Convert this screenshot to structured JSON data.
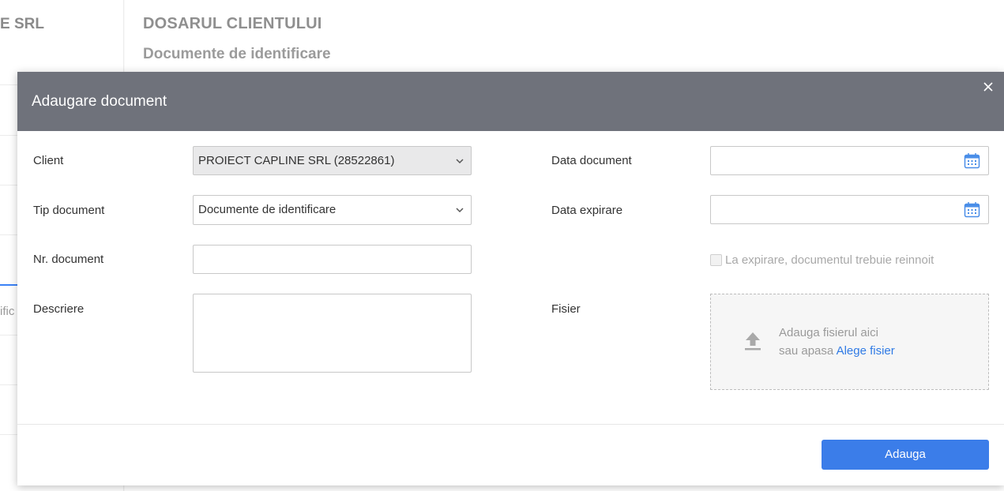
{
  "background": {
    "company_partial": "E SRL",
    "page_title": "DOSARUL CLIENTULUI",
    "page_subtitle": "Documente de identificare",
    "sidebar_partial_text": "ific"
  },
  "modal": {
    "title": "Adaugare document",
    "close_icon": "close-icon",
    "fields": {
      "client": {
        "label": "Client",
        "value": "PROIECT CAPLINE SRL (28522861)"
      },
      "tip_document": {
        "label": "Tip document",
        "value": "Documente de identificare"
      },
      "nr_document": {
        "label": "Nr. document",
        "value": ""
      },
      "descriere": {
        "label": "Descriere",
        "value": ""
      },
      "data_document": {
        "label": "Data document",
        "value": ""
      },
      "data_expirare": {
        "label": "Data expirare",
        "value": ""
      },
      "reinnoire_checkbox": {
        "label": "La expirare, documentul trebuie reinnoit",
        "checked": false
      },
      "fisier": {
        "label": "Fisier",
        "drop_line1": "Adauga fisierul aici",
        "drop_line2_prefix": "sau apasa ",
        "drop_link": "Alege fisier"
      }
    },
    "submit_label": "Adauga"
  },
  "colors": {
    "header_bg": "#6f727b",
    "primary": "#3b7de9",
    "link": "#2f7ae5",
    "disabled_field": "#e9e9ea"
  },
  "icons": [
    "close-icon",
    "chevron-down-icon",
    "calendar-icon",
    "upload-icon"
  ]
}
